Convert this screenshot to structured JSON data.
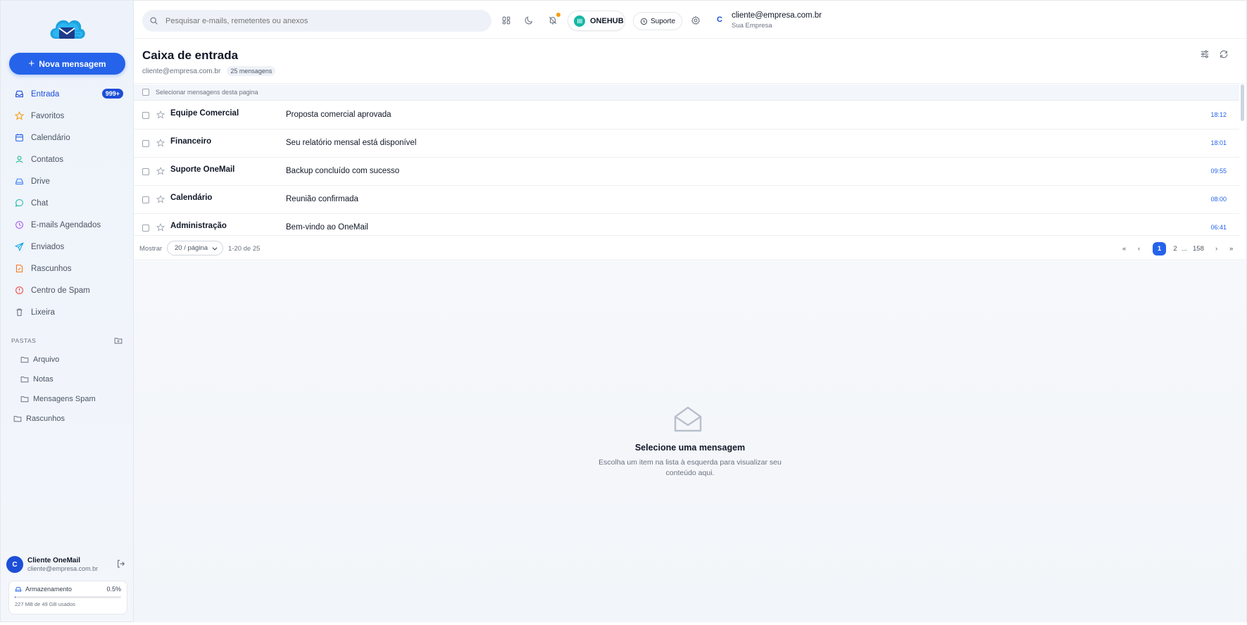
{
  "sidebar": {
    "compose_label": "Nova mensagem",
    "items": [
      {
        "label": "Entrada",
        "badge": "999+",
        "icon": "inbox-icon"
      },
      {
        "label": "Favoritos",
        "icon": "star-icon"
      },
      {
        "label": "Calendário",
        "icon": "calendar-icon"
      },
      {
        "label": "Contatos",
        "icon": "user-icon"
      },
      {
        "label": "Drive",
        "icon": "drive-icon"
      },
      {
        "label": "Chat",
        "icon": "chat-icon"
      },
      {
        "label": "E-mails Agendados",
        "icon": "clock-icon"
      },
      {
        "label": "Enviados",
        "icon": "send-icon"
      },
      {
        "label": "Rascunhos",
        "icon": "draft-icon"
      },
      {
        "label": "Centro de Spam",
        "icon": "alert-icon"
      },
      {
        "label": "Lixeira",
        "icon": "trash-icon"
      }
    ],
    "folders_heading": "PASTAS",
    "folders": [
      {
        "label": "Arquivo"
      },
      {
        "label": "Notas"
      },
      {
        "label": "Mensagens Spam"
      },
      {
        "label": "Rascunhos"
      }
    ],
    "user": {
      "initial": "C",
      "name": "Cliente OneMail",
      "email": "cliente@empresa.com.br"
    },
    "storage": {
      "label": "Armazenamento",
      "percent": "0.5%",
      "used_fraction": 0.005,
      "detail": "227 MB de 49 GB usados"
    }
  },
  "topbar": {
    "search_placeholder": "Pesquisar e-mails, remetentes ou anexos",
    "onehub_label": "ONEHUB",
    "support_label": "Suporte",
    "account_initial": "C",
    "account_email": "cliente@empresa.com.br",
    "account_org": "Sua Empresa"
  },
  "inbox": {
    "title": "Caixa de entrada",
    "email": "cliente@empresa.com.br",
    "count": "25 mensagens",
    "select_label": "Selecionar mensagens desta pagina",
    "messages": [
      {
        "sender": "Equipe Comercial",
        "subject": "Proposta comercial aprovada",
        "time": "18:12"
      },
      {
        "sender": "Financeiro",
        "subject": "Seu relatório mensal está disponível",
        "time": "18:01"
      },
      {
        "sender": "Suporte OneMail",
        "subject": "Backup concluído com sucesso",
        "time": "09:55"
      },
      {
        "sender": "Calendário",
        "subject": "Reunião confirmada",
        "time": "08:00"
      },
      {
        "sender": "Administração",
        "subject": "Bem-vindo ao OneMail",
        "time": "06:41"
      }
    ]
  },
  "pagination": {
    "show_label": "Mostrar",
    "per_page": "20 / página",
    "range": "1-20 de 25",
    "first": "«",
    "prev": "‹",
    "pages": [
      "1",
      "2",
      "...",
      "158"
    ],
    "next": "›",
    "last": "»"
  },
  "reading_pane": {
    "title": "Selecione uma mensagem",
    "description": "Escolha um item na lista à esquerda para visualizar seu conteúdo aqui."
  },
  "colors": {
    "accent": "#2563eb",
    "badge": "#1d4ed8",
    "notification": "#f59e0b",
    "onehub": "#14b8a6"
  }
}
